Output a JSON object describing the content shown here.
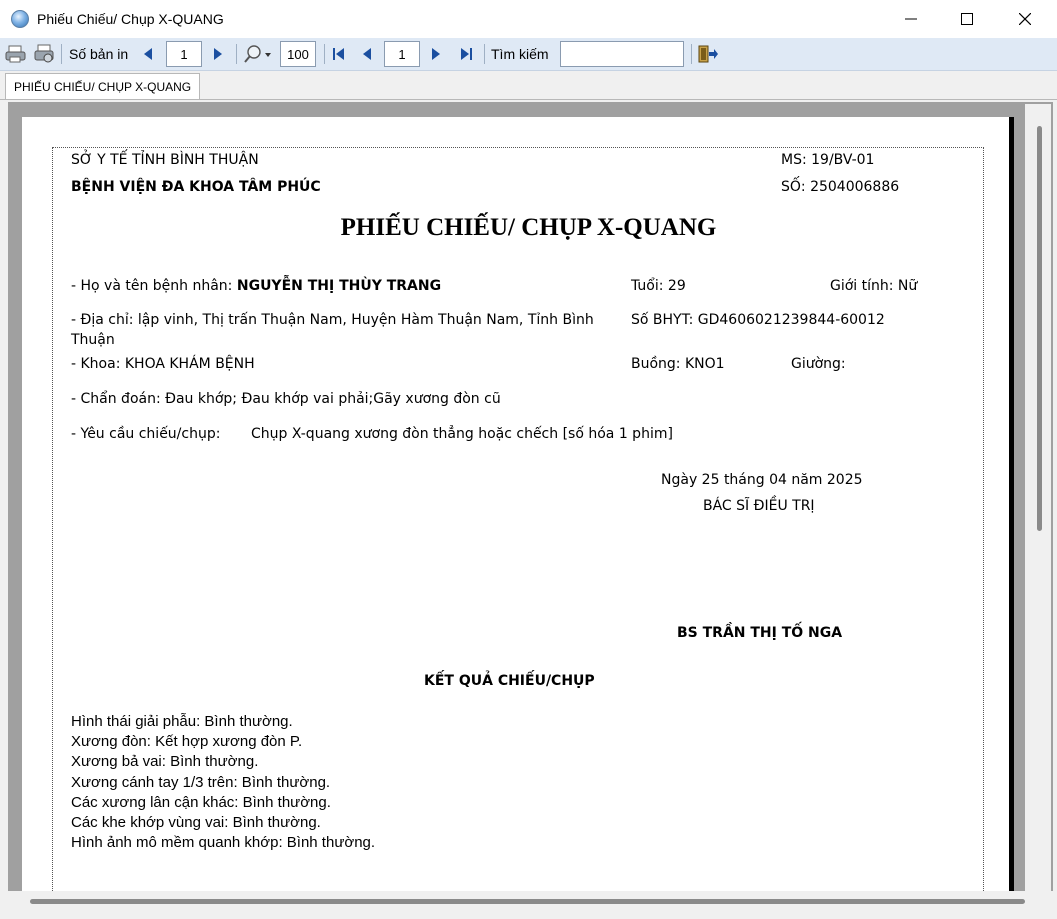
{
  "window": {
    "title": "Phiếu Chiếu/ Chụp X-QUANG"
  },
  "toolbar": {
    "copies_label": "Số bản in",
    "copies_value": "1",
    "zoom_value": "100",
    "page_value": "1",
    "search_label": "Tìm kiếm",
    "search_value": ""
  },
  "tab": {
    "label": "PHIẾU CHIẾU/ CHỤP X-QUANG"
  },
  "document": {
    "dept_header": "SỞ Y TẾ TỈNH BÌNH THUẬN",
    "hospital_name": "BỆNH VIỆN ĐA KHOA TÂM PHÚC",
    "form_code": "MS: 19/BV-01",
    "form_number": "SỐ: 2504006886",
    "title": "PHIẾU CHIẾU/ CHỤP X-QUANG",
    "patient_name_label": "- Họ và tên bệnh nhân:",
    "patient_name": "NGUYỄN THỊ THÙY TRANG",
    "age": "Tuổi: 29",
    "gender": "Giới tính: Nữ",
    "address_line1": "- Địa chỉ: lập vinh, Thị trấn Thuận Nam, Huyện Hàm Thuận Nam, Tỉnh Bình",
    "address_line2": "Thuận",
    "insurance": "Số BHYT: GD4606021239844-60012",
    "department": "- Khoa: KHOA KHÁM BỆNH",
    "room": "Buồng: KNO1",
    "bed": "Giường:",
    "diagnosis": "- Chẩn đoán: Đau khớp; Đau khớp vai phải;Gãy xương đòn cũ",
    "request_label": "- Yêu cầu chiếu/chụp:",
    "request_value": "Chụp X-quang xương đòn thẳng hoặc chếch [số hóa 1 phim]",
    "date": "Ngày 25 tháng 04 năm 2025",
    "doctor_title": "BÁC SĨ ĐIỀU TRỊ",
    "doctor_name": "BS TRẦN THỊ TỐ NGA",
    "results_title": "KẾT QUẢ CHIẾU/CHỤP",
    "results": [
      "Hình thái giải phẫu: Bình thường.",
      "Xương đòn: Kết hợp xương đòn P.",
      "Xương bả vai: Bình thường.",
      "Xương cánh tay 1/3 trên: Bình thường.",
      "Các xương lân cận khác: Bình thường.",
      "Các khe khớp vùng vai: Bình thường.",
      "Hình ảnh mô mềm quanh khớp: Bình thường."
    ]
  }
}
